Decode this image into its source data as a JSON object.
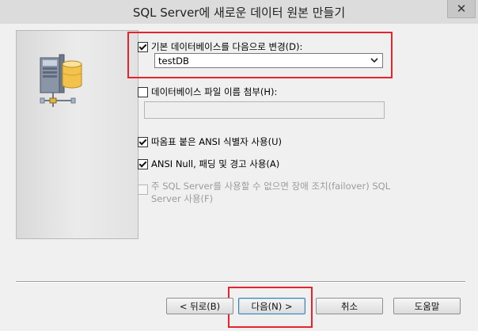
{
  "window": {
    "title": "SQL Server에 새로운 데이터 원본 만들기",
    "close_glyph": "✕"
  },
  "options": {
    "default_db": {
      "label": "기본 데이터베이스를 다음으로 변경(D):",
      "checked": true,
      "selected_value": "testDB"
    },
    "attach_db": {
      "label": "데이터베이스 파일 이름 첨부(H):",
      "checked": false,
      "field_value": ""
    },
    "quoted_identifiers": {
      "label": "따옴표 붙은 ANSI 식별자 사용(U)",
      "checked": true
    },
    "ansi_nulls": {
      "label": "ANSI Null, 패딩 및 경고 사용(A)",
      "checked": true
    },
    "failover": {
      "label_line1": "주 SQL Server를 사용할 수 없으면 장애 조치(failover) SQL",
      "label_line2": "Server 사용(F)",
      "checked": false,
      "enabled": false
    }
  },
  "buttons": {
    "back": "< 뒤로(B)",
    "next": "다음(N) >",
    "cancel": "취소",
    "help": "도움말"
  },
  "colors": {
    "highlight": "#e5242d",
    "cylinder": "#f2c24a"
  },
  "icons": {
    "server": "server-database-icon",
    "dropdown": "chevron-down-icon",
    "close": "close-icon"
  }
}
